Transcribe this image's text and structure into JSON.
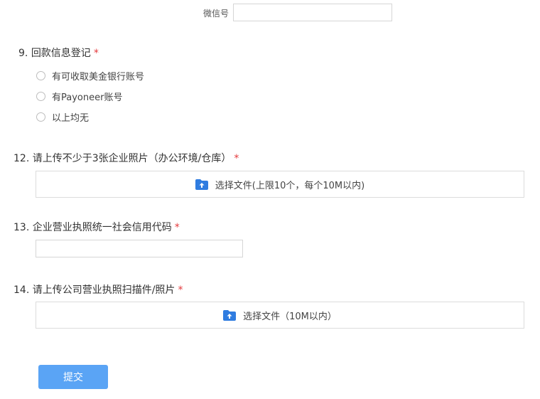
{
  "wechat": {
    "label": "微信号",
    "value": ""
  },
  "q9": {
    "number": "9.",
    "title": "回款信息登记",
    "required": "*",
    "options": [
      "有可收取美金银行账号",
      "有Payoneer账号",
      "以上均无"
    ]
  },
  "q12": {
    "number": "12.",
    "title": "请上传不少于3张企业照片（办公环境/仓库）",
    "required": "*",
    "upload_label": "选择文件(上限10个，每个10M以内)"
  },
  "q13": {
    "number": "13.",
    "title": "企业营业执照统一社会信用代码",
    "required": "*",
    "value": ""
  },
  "q14": {
    "number": "14.",
    "title": "请上传公司营业执照扫描件/照片",
    "required": "*",
    "upload_label": "选择文件（10M以内）"
  },
  "submit": {
    "label": "提交"
  },
  "colors": {
    "accent": "#5aa4f5",
    "required": "#e4393c",
    "upload_icon": "#2f7ce0"
  }
}
